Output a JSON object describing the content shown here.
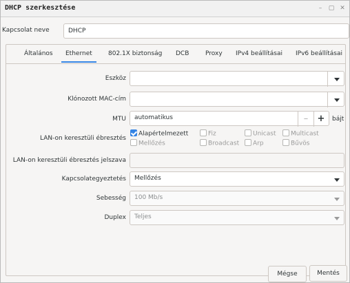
{
  "window": {
    "title": "DHCP szerkesztése",
    "controls": {
      "minimize": "–",
      "maximize": "▢",
      "close": "✕"
    }
  },
  "connection": {
    "label": "Kapcsolat neve",
    "value": "DHCP"
  },
  "tabs": [
    {
      "label": "Általános",
      "active": false
    },
    {
      "label": "Ethernet",
      "active": true
    },
    {
      "label": "802.1X biztonság",
      "active": false
    },
    {
      "label": "DCB",
      "active": false
    },
    {
      "label": "Proxy",
      "active": false
    },
    {
      "label": "IPv4 beállításai",
      "active": false
    },
    {
      "label": "IPv6 beállításai",
      "active": false
    }
  ],
  "ethernet": {
    "device": {
      "label": "Eszköz",
      "value": ""
    },
    "mac": {
      "label": "Klónozott MAC-cím",
      "value": ""
    },
    "mtu": {
      "label": "MTU",
      "value": "automatikus",
      "minus": "–",
      "plus": "+",
      "unit": "bájt"
    },
    "wol": {
      "label": "LAN-on keresztüli ébresztés",
      "options": [
        {
          "label": "Alapértelmezett",
          "checked": true,
          "enabled": true
        },
        {
          "label": "Fiz",
          "checked": false,
          "enabled": false
        },
        {
          "label": "Unicast",
          "checked": false,
          "enabled": false
        },
        {
          "label": "Multicast",
          "checked": false,
          "enabled": false
        },
        {
          "label": "Mellőzés",
          "checked": false,
          "enabled": false
        },
        {
          "label": "Broadcast",
          "checked": false,
          "enabled": false
        },
        {
          "label": "Arp",
          "checked": false,
          "enabled": false
        },
        {
          "label": "Bűvös",
          "checked": false,
          "enabled": false
        }
      ]
    },
    "wol_password": {
      "label": "LAN-on keresztüli ébresztés jelszava",
      "value": ""
    },
    "negotiation": {
      "label": "Kapcsolategyeztetés",
      "value": "Mellőzés"
    },
    "speed": {
      "label": "Sebesség",
      "value": "100 Mb/s"
    },
    "duplex": {
      "label": "Duplex",
      "value": "Teljes"
    }
  },
  "buttons": {
    "cancel": "Mégse",
    "save": "Mentés"
  },
  "colors": {
    "accent": "#3584e4",
    "background": "#f6f5f4",
    "border": "#cdc7c2"
  }
}
